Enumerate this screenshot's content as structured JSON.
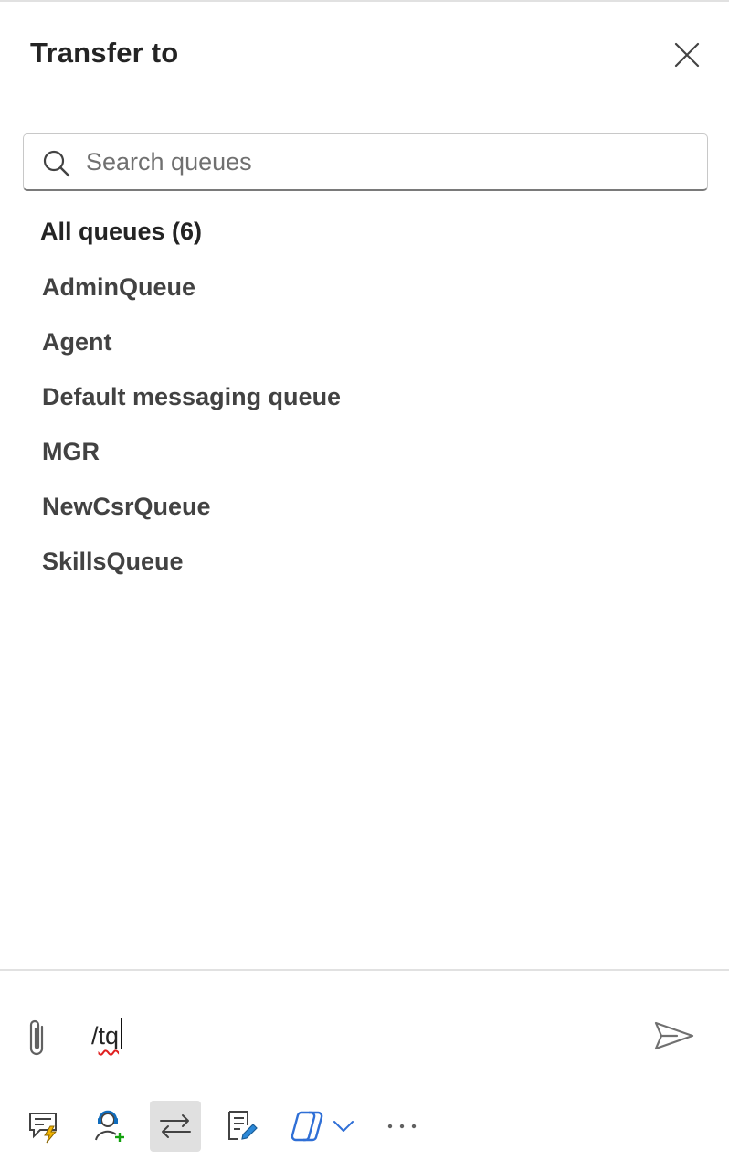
{
  "panel": {
    "title": "Transfer to",
    "close_icon": "close-icon"
  },
  "search": {
    "placeholder": "Search queues",
    "value": "",
    "icon": "search-icon"
  },
  "queues": {
    "group_heading": "All queues (6)",
    "items": [
      {
        "label": "AdminQueue"
      },
      {
        "label": "Agent"
      },
      {
        "label": "Default messaging queue"
      },
      {
        "label": "MGR"
      },
      {
        "label": "NewCsrQueue"
      },
      {
        "label": "SkillsQueue"
      }
    ]
  },
  "composer": {
    "text_prefix": "/",
    "text_misspelled": "tq",
    "attach_icon": "paperclip-icon",
    "send_icon": "send-icon"
  },
  "toolbar": {
    "tools": [
      {
        "name": "quick-replies-icon"
      },
      {
        "name": "consult-agent-icon"
      },
      {
        "name": "transfer-icon",
        "active": true
      },
      {
        "name": "notes-icon"
      },
      {
        "name": "copilot-icon"
      },
      {
        "name": "chevron-down-icon"
      },
      {
        "name": "more-icon"
      }
    ]
  },
  "colors": {
    "accent_blue": "#0f6cbd",
    "copilot_blue": "#2f6fd6",
    "lightning_amber": "#f2b400",
    "add_green": "#13a10e",
    "active_tool_bg": "#e0e0e0"
  }
}
